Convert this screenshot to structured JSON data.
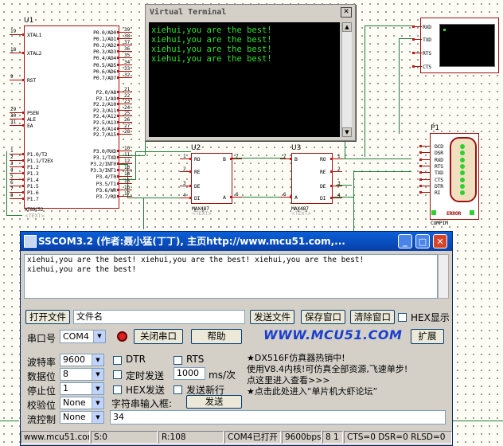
{
  "schematic": {
    "u1": {
      "ref": "U1",
      "part": "AT89C52",
      "sub": "<TEXT>",
      "left_pins": [
        {
          "num": "19",
          "label": "XTAL1"
        },
        {
          "num": "18",
          "label": "XTAL2"
        },
        {
          "num": "9",
          "label": "RST"
        },
        {
          "num": "29",
          "label": "PSEN"
        },
        {
          "num": "30",
          "label": "ALE"
        },
        {
          "num": "31",
          "label": "EA"
        },
        {
          "num": "1",
          "label": "P1.0/T2"
        },
        {
          "num": "2",
          "label": "P1.1/T2EX"
        },
        {
          "num": "3",
          "label": "P1.2"
        },
        {
          "num": "4",
          "label": "P1.3"
        },
        {
          "num": "5",
          "label": "P1.4"
        },
        {
          "num": "6",
          "label": "P1.5"
        },
        {
          "num": "7",
          "label": "P1.6"
        },
        {
          "num": "8",
          "label": "P1.7"
        }
      ],
      "right_pins": [
        {
          "num": "39",
          "label": "P0.0/AD0"
        },
        {
          "num": "38",
          "label": "P0.1/AD1"
        },
        {
          "num": "37",
          "label": "P0.2/AD2"
        },
        {
          "num": "36",
          "label": "P0.3/AD3"
        },
        {
          "num": "35",
          "label": "P0.4/AD4"
        },
        {
          "num": "34",
          "label": "P0.5/AD5"
        },
        {
          "num": "33",
          "label": "P0.6/AD6"
        },
        {
          "num": "32",
          "label": "P0.7/AD7"
        },
        {
          "num": "21",
          "label": "P2.0/A8"
        },
        {
          "num": "22",
          "label": "P2.1/A9"
        },
        {
          "num": "23",
          "label": "P2.2/A10"
        },
        {
          "num": "24",
          "label": "P2.3/A11"
        },
        {
          "num": "25",
          "label": "P2.4/A12"
        },
        {
          "num": "26",
          "label": "P2.5/A13"
        },
        {
          "num": "27",
          "label": "P2.6/A14"
        },
        {
          "num": "28",
          "label": "P2.7/A15"
        },
        {
          "num": "10",
          "label": "P3.0/RXD"
        },
        {
          "num": "11",
          "label": "P3.1/TXD"
        },
        {
          "num": "12",
          "label": "P3.2/INT0"
        },
        {
          "num": "13",
          "label": "P3.3/INT1"
        },
        {
          "num": "14",
          "label": "P3.4/T0"
        },
        {
          "num": "15",
          "label": "P3.5/T1"
        },
        {
          "num": "16",
          "label": "P3.6/WR"
        },
        {
          "num": "17",
          "label": "P3.7/RD"
        }
      ]
    },
    "u2": {
      "ref": "U2",
      "part": "MAX487",
      "sub": "<TEXT>",
      "pins_left": [
        "RO",
        "RE",
        "DE",
        "DI"
      ],
      "pins_right": [
        "B",
        "A"
      ],
      "nums_left": [
        "1",
        "2",
        "3",
        "4"
      ],
      "nums_right": [
        "7",
        "6"
      ]
    },
    "u3": {
      "ref": "U3",
      "part": "MAX487",
      "sub": "<TEXT>",
      "pins_left": [
        "B",
        "A"
      ],
      "pins_right": [
        "RO",
        "RE",
        "DE",
        "DI"
      ],
      "nums_left": [
        "7",
        "6"
      ],
      "nums_right": [
        "1",
        "2",
        "3",
        "4"
      ]
    },
    "p1": {
      "ref": "P1",
      "part": "COMPIM",
      "pins": [
        "DCD",
        "DSR",
        "RXD",
        "RTS",
        "TXD",
        "CTS",
        "DTR",
        "RI"
      ],
      "error": "ERROR"
    },
    "vterm_device": {
      "pins": [
        "RXD",
        "TXD",
        "RTS",
        "CTS"
      ]
    }
  },
  "virtual_terminal": {
    "title": "Virtual Terminal",
    "lines": [
      "xiehui,you are the best!",
      "xiehui,you are the best!",
      "xiehui,you are the best!",
      "xiehui,you are the best!"
    ]
  },
  "sscom": {
    "title": "SSCOM3.2 (作者:聂小猛(丁丁), 主页http://www.mcu51.com,...",
    "receive_text": "xiehui,you are the best! xiehui,you are the best! xiehui,you are the best!\nxiehui,you are the best!",
    "open_file_label": "打开文件",
    "filename_value": "文件名",
    "send_file_label": "发送文件",
    "save_window_label": "保存窗口",
    "clear_window_label": "清除窗口",
    "hex_show_label": "HEX显示",
    "port_label": "串口号",
    "port_value": "COM4",
    "close_port_label": "关闭串口",
    "help_label": "帮助",
    "site_banner": "WWW.MCU51.COM",
    "expand_label": "扩展",
    "baud_label": "波特率",
    "baud_value": "9600",
    "databits_label": "数据位",
    "databits_value": "8",
    "stopbits_label": "停止位",
    "stopbits_value": "1",
    "parity_label": "校验位",
    "parity_value": "None",
    "flow_label": "流控制",
    "flow_value": "None",
    "dtr_label": "DTR",
    "rts_label": "RTS",
    "timed_send_label": "定时发送",
    "interval_value": "1000",
    "interval_unit": "ms/次",
    "hex_send_label": "HEX发送",
    "send_newline_label": "发送新行",
    "input_label": "字符串输入框:",
    "send_label": "发送",
    "input_value": "34",
    "ad_lines": [
      "★DX516F仿真器热销中!",
      "使用V8.4内核!可仿真全部资源,飞速单步!",
      "点这里进入查看>>>",
      "★点击此处进入“单片机大虾论坛”"
    ],
    "status": {
      "site": "www.mcu51.com",
      "sent": "S:0",
      "received": "R:108",
      "port_state": "COM4已打开",
      "baud": "9600bps",
      "frame": "8 1",
      "signals": "CTS=0 DSR=0 RLSD=0"
    }
  },
  "colors": {
    "wire": "#1f7a3a",
    "chip_border": "#a01010",
    "terminal_text": "#2fe12f",
    "title_bar": "#0a5fd8",
    "banner": "#1a3fd0"
  }
}
